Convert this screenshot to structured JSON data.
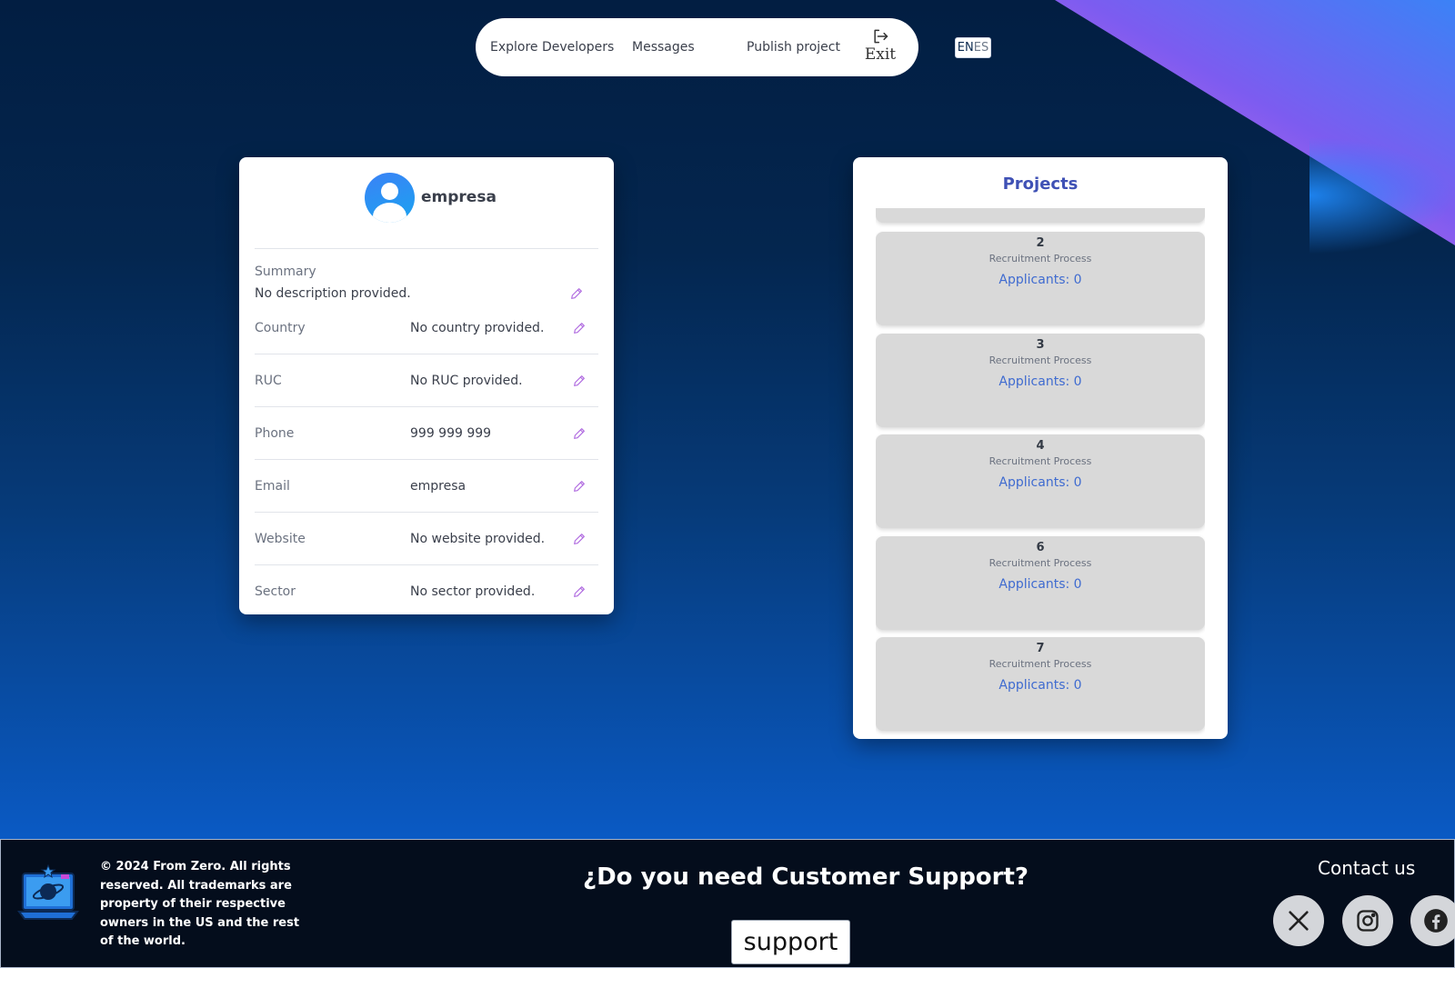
{
  "nav": {
    "explore": "Explore Developers",
    "messages": "Messages",
    "publish": "Publish project",
    "exit": "Exit",
    "lang_en": "EN",
    "lang_es": "ES"
  },
  "profile": {
    "username": "empresa",
    "summary_label": "Summary",
    "summary_value": "No description provided.",
    "fields": [
      {
        "label": "Country",
        "value": "No country provided."
      },
      {
        "label": "RUC",
        "value": "No RUC provided."
      },
      {
        "label": "Phone",
        "value": "999 999 999"
      },
      {
        "label": "Email",
        "value": "empresa"
      },
      {
        "label": "Website",
        "value": "No website provided."
      },
      {
        "label": "Sector",
        "value": "No sector provided."
      }
    ],
    "edit_icon": "pencil-icon",
    "accent": "#b06be0"
  },
  "projects": {
    "title": "Projects",
    "items": [
      {
        "name": "2",
        "process": "Recruitment Process",
        "applicants": "Applicants: 0"
      },
      {
        "name": "3",
        "process": "Recruitment Process",
        "applicants": "Applicants: 0"
      },
      {
        "name": "4",
        "process": "Recruitment Process",
        "applicants": "Applicants: 0"
      },
      {
        "name": "6",
        "process": "Recruitment Process",
        "applicants": "Applicants: 0"
      },
      {
        "name": "7",
        "process": "Recruitment Process",
        "applicants": "Applicants: 0"
      }
    ]
  },
  "footer": {
    "copyright": "© 2024 From Zero. All rights reserved. All trademarks are property of their respective owners in the US and the rest of the world.",
    "support_question": "¿Do you need Customer Support?",
    "support_button": "support",
    "contact": "Contact us",
    "social_icons": [
      "x-icon",
      "instagram-icon",
      "facebook-icon"
    ]
  },
  "colors": {
    "bg_top": "#021e42",
    "bg_bottom": "#0a5ac4",
    "projects_title": "#3f51b5",
    "applicants": "#3f6bd0",
    "footer_bg": "#040d1c"
  }
}
